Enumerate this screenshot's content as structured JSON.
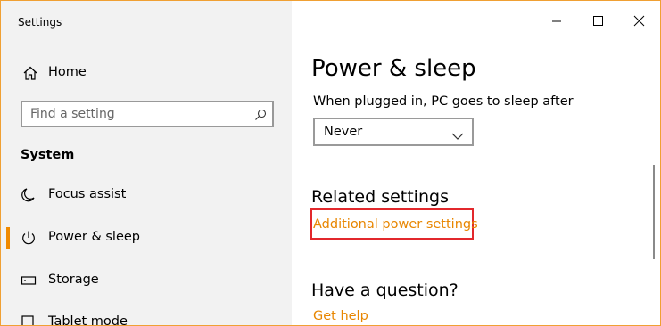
{
  "window": {
    "title": "Settings",
    "accent_color": "#f08a00",
    "border_color": "#f0a033"
  },
  "sidebar": {
    "home_label": "Home",
    "search": {
      "placeholder": "Find a setting"
    },
    "section_heading": "System",
    "items": [
      {
        "label": "Focus assist",
        "icon": "moon-icon",
        "selected": false
      },
      {
        "label": "Power & sleep",
        "icon": "power-icon",
        "selected": true
      },
      {
        "label": "Storage",
        "icon": "storage-icon",
        "selected": false
      },
      {
        "label": "Tablet mode",
        "icon": "tablet-icon",
        "selected": false
      }
    ]
  },
  "main": {
    "page_title": "Power & sleep",
    "sleep_label": "When plugged in, PC goes to sleep after",
    "sleep_value": "Never",
    "related_heading": "Related settings",
    "related_link": "Additional power settings",
    "question_heading": "Have a question?",
    "help_link": "Get help",
    "link_color": "#e88600",
    "highlight_color": "#e2282c"
  }
}
